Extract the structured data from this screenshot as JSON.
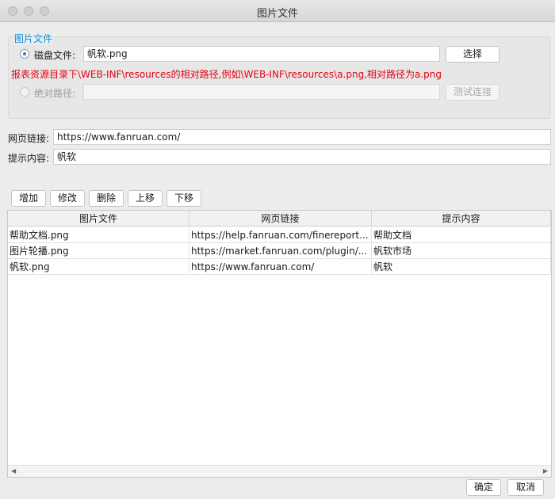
{
  "window": {
    "title": "图片文件"
  },
  "image_group": {
    "legend": "图片文件",
    "disk_label": "磁盘文件:",
    "disk_value": "帆软.png",
    "choose_button": "选择",
    "hint": "报表资源目录下\\WEB-INF\\resources的相对路径,例如\\WEB-INF\\resources\\a.png,相对路径为a.png",
    "absolute_label": "绝对路径:",
    "absolute_value": "",
    "test_button": "测试连接",
    "selected_source": "disk"
  },
  "web_link": {
    "label": "网页链接:",
    "value": "https://www.fanruan.com/"
  },
  "tooltip": {
    "label": "提示内容:",
    "value": "帆软"
  },
  "toolbar": {
    "add": "增加",
    "edit": "修改",
    "delete": "删除",
    "up": "上移",
    "down": "下移"
  },
  "table": {
    "headers": [
      "图片文件",
      "网页链接",
      "提示内容"
    ],
    "rows": [
      {
        "image": "帮助文档.png",
        "link": "https://help.fanruan.com/finereport...",
        "tip": "帮助文档"
      },
      {
        "image": "图片轮播.png",
        "link": "https://market.fanruan.com/plugin/...",
        "tip": "帆软市场"
      },
      {
        "image": "帆软.png",
        "link": "https://www.fanruan.com/",
        "tip": "帆软"
      }
    ]
  },
  "footer": {
    "ok": "确定",
    "cancel": "取消"
  }
}
